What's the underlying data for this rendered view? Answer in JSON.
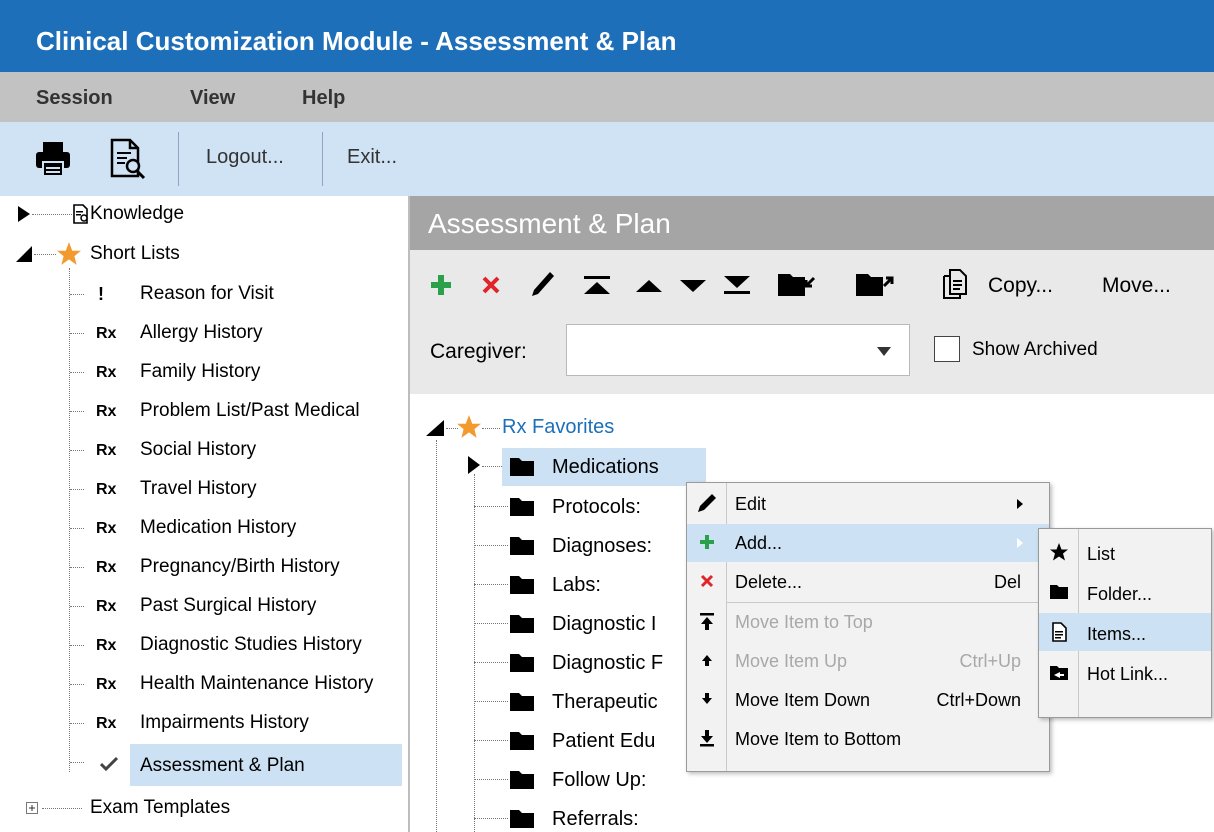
{
  "window": {
    "title": "Clinical Customization Module - Assessment & Plan"
  },
  "menu": [
    "Session",
    "View",
    "Help"
  ],
  "toolbar": {
    "logout_label": "Logout...",
    "exit_label": "Exit..."
  },
  "left_tree": {
    "knowledge": "Knowledge",
    "short_lists": "Short Lists",
    "rx_badge": "Rx",
    "items": [
      {
        "label": "Reason for Visit",
        "icon": "!"
      },
      {
        "label": "Allergy History",
        "icon": "Rx"
      },
      {
        "label": "Family History",
        "icon": "Rx"
      },
      {
        "label": "Problem List/Past Medical",
        "icon": "Rx"
      },
      {
        "label": "Social History",
        "icon": "Rx"
      },
      {
        "label": "Travel History",
        "icon": "Rx"
      },
      {
        "label": "Medication History",
        "icon": "Rx"
      },
      {
        "label": "Pregnancy/Birth History",
        "icon": "Rx"
      },
      {
        "label": "Past Surgical History",
        "icon": "Rx"
      },
      {
        "label": "Diagnostic Studies History",
        "icon": "Rx"
      },
      {
        "label": "Health Maintenance History",
        "icon": "Rx"
      },
      {
        "label": "Impairments History",
        "icon": "Rx"
      },
      {
        "label": "Assessment & Plan",
        "icon": "check",
        "selected": true
      }
    ],
    "exam_templates": "Exam Templates"
  },
  "right_panel": {
    "title": "Assessment & Plan",
    "copy_label": "Copy...",
    "move_label": "Move...",
    "caregiver_label": "Caregiver:",
    "caregiver_value": "",
    "show_archived_label": "Show Archived",
    "show_archived_checked": false
  },
  "rx_tree": {
    "root": "Rx Favorites",
    "folders": [
      "Medications",
      "Protocols:",
      "Diagnoses:",
      "Labs:",
      "Diagnostic I",
      "Diagnostic F",
      "Therapeutic",
      "Patient Edu",
      "Follow Up:",
      "Referrals:"
    ]
  },
  "context_menu": {
    "items": [
      {
        "label": "Edit",
        "shortcut": "",
        "submenu": true,
        "disabled": false,
        "icon": "pencil-icon"
      },
      {
        "label": "Add...",
        "shortcut": "",
        "submenu": true,
        "disabled": false,
        "icon": "plus-icon",
        "highlighted": true
      },
      {
        "label": "Delete...",
        "shortcut": "Del",
        "submenu": false,
        "disabled": false,
        "icon": "x-icon"
      },
      {
        "label": "Move Item to Top",
        "shortcut": "",
        "submenu": false,
        "disabled": true,
        "icon": "top-arrow-icon"
      },
      {
        "label": "Move Item Up",
        "shortcut": "Ctrl+Up",
        "submenu": false,
        "disabled": true,
        "icon": "up-arrow-icon"
      },
      {
        "label": "Move Item Down",
        "shortcut": "Ctrl+Down",
        "submenu": false,
        "disabled": false,
        "icon": "down-arrow-icon"
      },
      {
        "label": "Move Item to Bottom",
        "shortcut": "",
        "submenu": false,
        "disabled": false,
        "icon": "bottom-arrow-icon"
      }
    ]
  },
  "submenu": {
    "items": [
      {
        "label": "List",
        "icon": "star-icon"
      },
      {
        "label": "Folder...",
        "icon": "folder-icon"
      },
      {
        "label": "Items...",
        "icon": "document-icon",
        "highlighted": true
      },
      {
        "label": "Hot Link...",
        "icon": "hotlink-icon"
      }
    ]
  },
  "colors": {
    "title_bar": "#1e6fba",
    "menu_bar": "#c2c2c2",
    "toolbar": "#cfe3f5",
    "selection": "#cce1f4",
    "panel_header": "#a5a5a5",
    "star": "#f29a2e",
    "add_green": "#2aa04a",
    "delete_red": "#e0242b",
    "link_blue": "#1e6fba"
  }
}
